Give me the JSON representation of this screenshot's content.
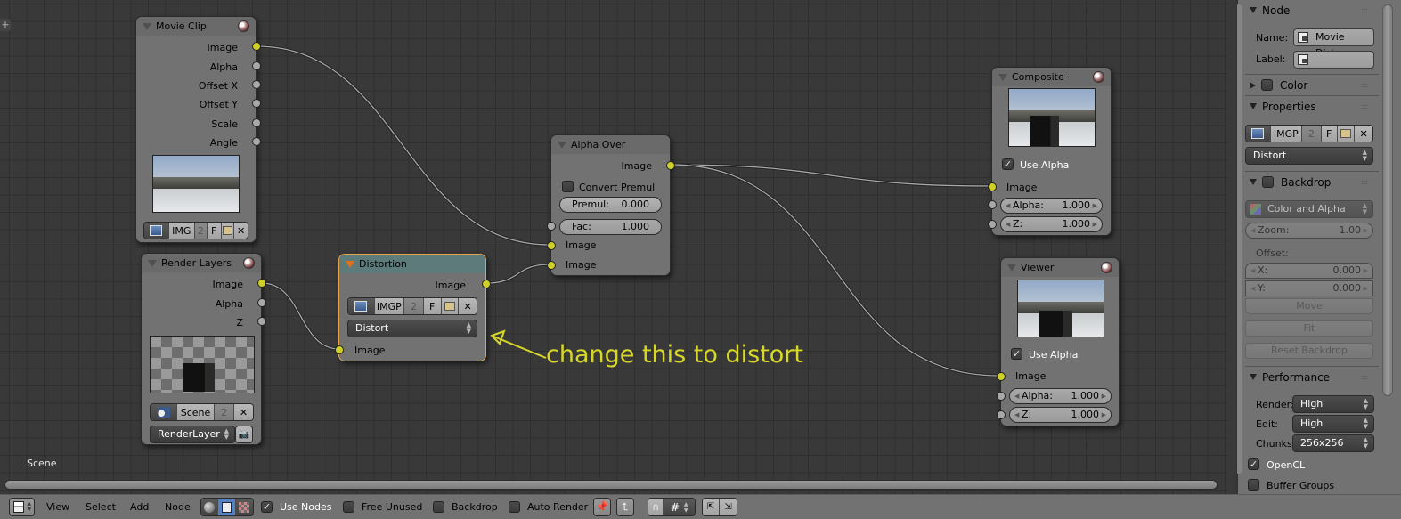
{
  "editor": {
    "corner_icon": "plus-icon",
    "scene_label": "Scene",
    "annotation": {
      "text": "change this to distort",
      "color": "#d7d72a"
    }
  },
  "colors": {
    "socket_image": "#cfcf2a",
    "socket_value": "#a8a8a8",
    "selected_outline": "#e8a34c",
    "selected_header": "#5e7b7c",
    "canvas_bg": "#393939"
  },
  "nodes": {
    "movie_clip": {
      "title": "Movie Clip",
      "outputs": [
        "Image",
        "Alpha",
        "Offset X",
        "Offset Y",
        "Scale",
        "Angle"
      ],
      "clip_bar": {
        "name": "IMG",
        "users": "2",
        "fake": "F"
      }
    },
    "render_layers": {
      "title": "Render Layers",
      "outputs": [
        "Image",
        "Alpha",
        "Z"
      ],
      "scene_bar": {
        "name": "Scene",
        "users": "2"
      },
      "layer": "RenderLayer"
    },
    "distortion": {
      "title": "Distortion",
      "output": "Image",
      "distortion_bar": {
        "name": "IMGP",
        "users": "2",
        "fake": "F"
      },
      "mode": "Distort",
      "input": "Image"
    },
    "alpha_over": {
      "title": "Alpha Over",
      "output": "Image",
      "convert_premul": {
        "label": "Convert Premul",
        "checked": false
      },
      "premul": {
        "label": "Premul:",
        "value": "0.000"
      },
      "fac": {
        "label": "Fac:",
        "value": "1.000"
      },
      "inputs": [
        "Image",
        "Image"
      ]
    },
    "composite": {
      "title": "Composite",
      "use_alpha": {
        "label": "Use Alpha",
        "checked": true
      },
      "inputs": {
        "image": "Image",
        "alpha_label": "Alpha:",
        "alpha_value": "1.000",
        "z_label": "Z:",
        "z_value": "1.000"
      }
    },
    "viewer": {
      "title": "Viewer",
      "use_alpha": {
        "label": "Use Alpha",
        "checked": true
      },
      "inputs": {
        "image": "Image",
        "alpha_label": "Alpha:",
        "alpha_value": "1.000",
        "z_label": "Z:",
        "z_value": "1.000"
      }
    }
  },
  "panel": {
    "node_section": {
      "title": "Node",
      "name_label": "Name:",
      "name_value": "Movie Dist...",
      "label_label": "Label:",
      "label_value": ""
    },
    "color_section": {
      "title": "Color"
    },
    "properties_section": {
      "title": "Properties",
      "bar": {
        "name": "IMGP",
        "users": "2",
        "fake": "F"
      },
      "mode": "Distort"
    },
    "backdrop_section": {
      "title": "Backdrop",
      "channels": "Color and Alpha",
      "zoom_label": "Zoom:",
      "zoom_value": "1.00",
      "offset_label": "Offset:",
      "x_label": "X:",
      "x_value": "0.000",
      "y_label": "Y:",
      "y_value": "0.000",
      "move": "Move",
      "fit": "Fit",
      "reset": "Reset Backdrop"
    },
    "performance_section": {
      "title": "Performance",
      "render_label": "Render:",
      "render_value": "High",
      "edit_label": "Edit:",
      "edit_value": "High",
      "chunks_label": "Chunks",
      "chunks_value": "256x256",
      "opencl": {
        "label": "OpenCL",
        "checked": true
      },
      "buffer_groups": {
        "label": "Buffer Groups",
        "checked": false
      }
    }
  },
  "header": {
    "menus": [
      "View",
      "Select",
      "Add",
      "Node"
    ],
    "use_nodes": {
      "label": "Use Nodes",
      "checked": true
    },
    "free_unused": {
      "label": "Free Unused",
      "checked": false
    },
    "backdrop": {
      "label": "Backdrop",
      "checked": false
    },
    "auto_render": {
      "label": "Auto Render",
      "checked": false
    }
  }
}
